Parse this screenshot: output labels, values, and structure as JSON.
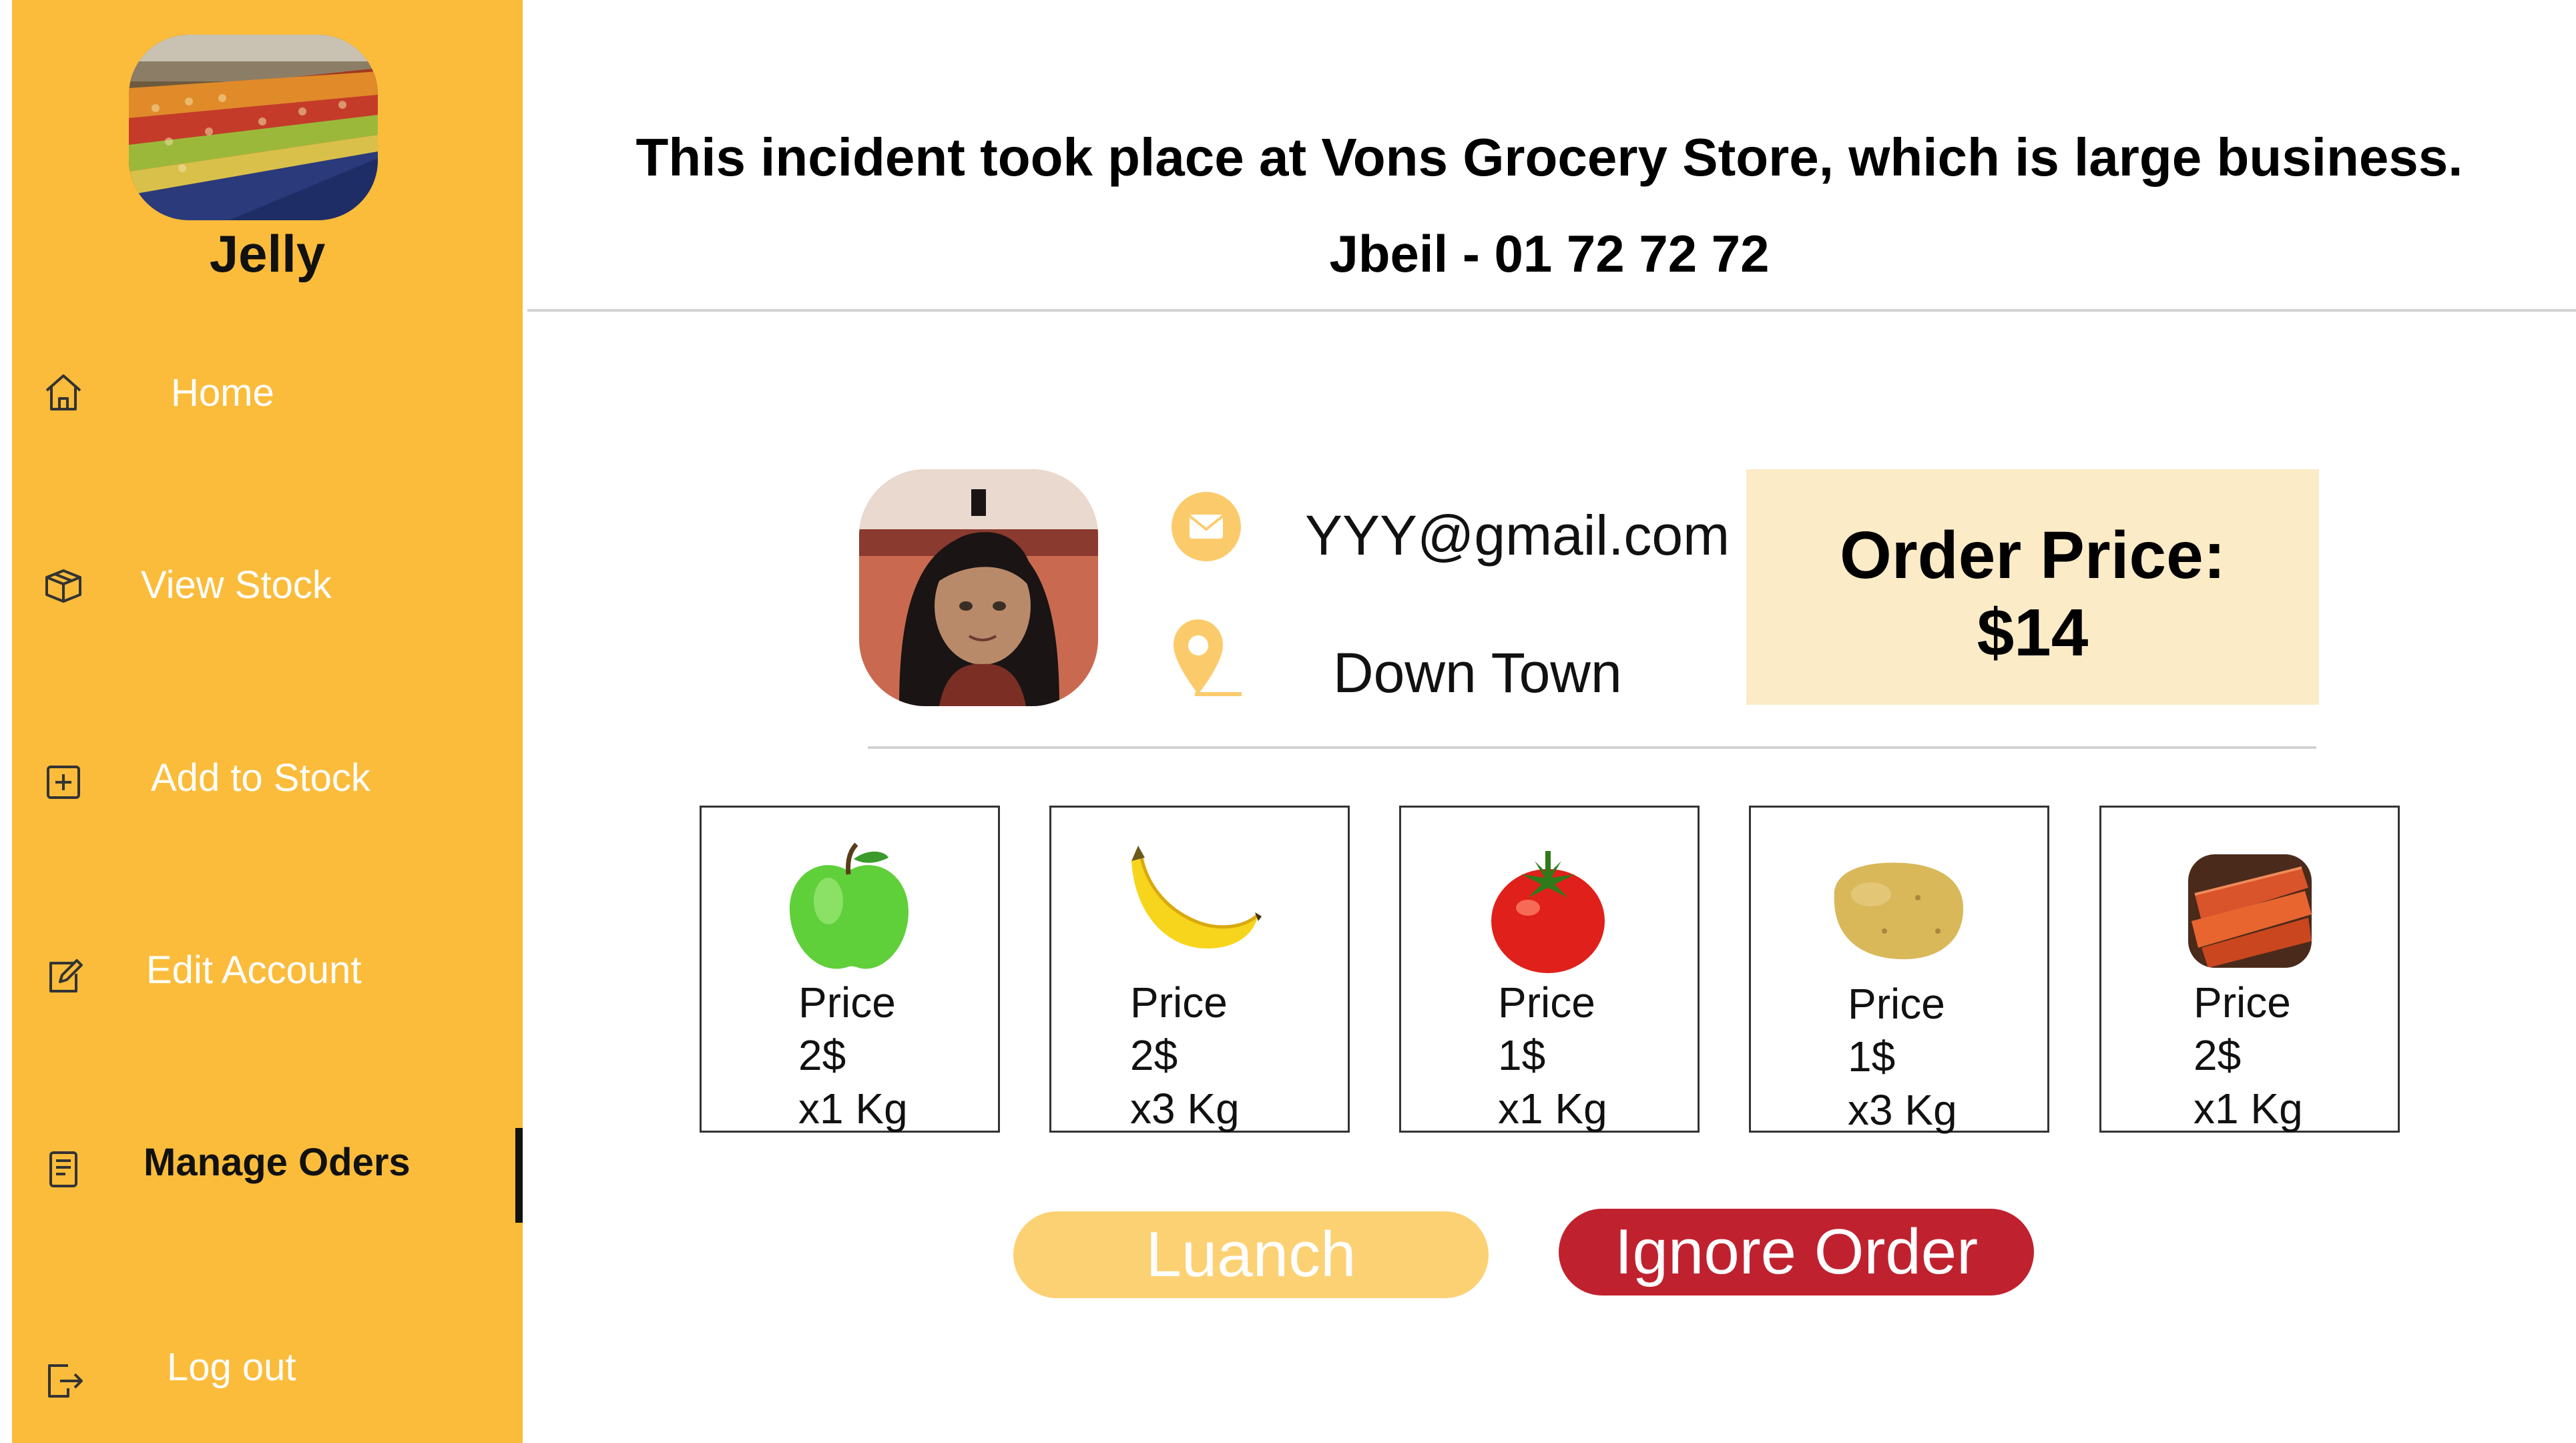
{
  "sidebar": {
    "store_name": "Jelly",
    "items": [
      {
        "label": "Home",
        "icon": "home-icon"
      },
      {
        "label": "View Stock",
        "icon": "box-icon"
      },
      {
        "label": "Add to Stock",
        "icon": "plus-square-icon"
      },
      {
        "label": "Edit Account",
        "icon": "edit-icon"
      },
      {
        "label": "Manage Oders",
        "icon": "orders-icon",
        "active": true
      },
      {
        "label": "Log out",
        "icon": "logout-icon"
      }
    ]
  },
  "header": {
    "title": "This incident took place at Vons Grocery Store, which is large business.",
    "subtitle": "Jbeil - 01 72 72 72"
  },
  "customer": {
    "email": "YYY@gmail.com",
    "address": "Down Town"
  },
  "order": {
    "price_label": "Order Price:",
    "price_value": "$14"
  },
  "items": [
    {
      "name": "apple",
      "price_label": "Price",
      "price": "2$",
      "quantity": "x1 Kg"
    },
    {
      "name": "banana",
      "price_label": "Price",
      "price": "2$",
      "quantity": "x3 Kg"
    },
    {
      "name": "tomato",
      "price_label": "Price",
      "price": "1$",
      "quantity": "x1 Kg"
    },
    {
      "name": "potato",
      "price_label": "Price",
      "price": "1$",
      "quantity": "x3 Kg"
    },
    {
      "name": "carrot",
      "price_label": "Price",
      "price": "2$",
      "quantity": "x1 Kg"
    }
  ],
  "actions": {
    "launch_label": "Luanch",
    "ignore_label": "Ignore Order"
  },
  "colors": {
    "sidebar": "#FBBC3B",
    "price_box": "#FCEBC7",
    "launch_button": "#FCD173",
    "ignore_button": "#C0212F",
    "info_icons": "#FBCB6B"
  }
}
